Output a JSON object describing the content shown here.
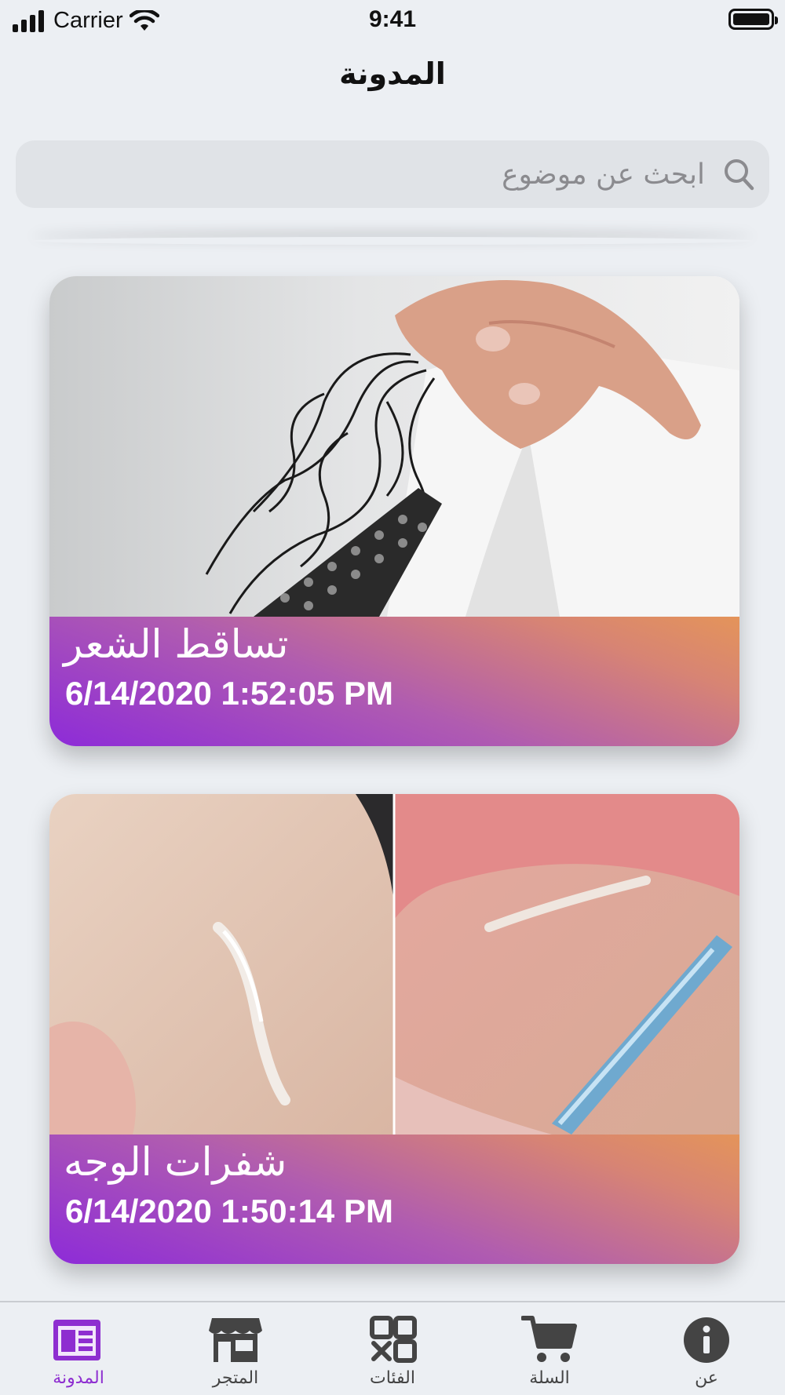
{
  "status_bar": {
    "carrier": "Carrier",
    "time": "9:41",
    "icons": [
      "signal-icon",
      "wifi-icon",
      "battery-icon"
    ]
  },
  "nav": {
    "title": "المدونة"
  },
  "search": {
    "placeholder": "ابحث عن موضوع",
    "icon": "search-icon"
  },
  "posts": [
    {
      "title": "تساقط الشعر",
      "date": "6/14/2020 1:52:05 PM"
    },
    {
      "title": "شفرات الوجه",
      "date": "6/14/2020 1:50:14 PM"
    }
  ],
  "tab_bar": {
    "tabs": [
      {
        "label": "المدونة",
        "icon": "blog-icon",
        "active": true
      },
      {
        "label": "المتجر",
        "icon": "store-icon",
        "active": false
      },
      {
        "label": "الفئات",
        "icon": "categories-icon",
        "active": false
      },
      {
        "label": "السلة",
        "icon": "cart-icon",
        "active": false
      },
      {
        "label": "عن",
        "icon": "info-icon",
        "active": false
      }
    ]
  },
  "colors": {
    "accent": "#8e2ed0",
    "caption_gradient_start": "#8d2bd8",
    "caption_gradient_end": "#e4945a",
    "background": "#eceff3"
  }
}
